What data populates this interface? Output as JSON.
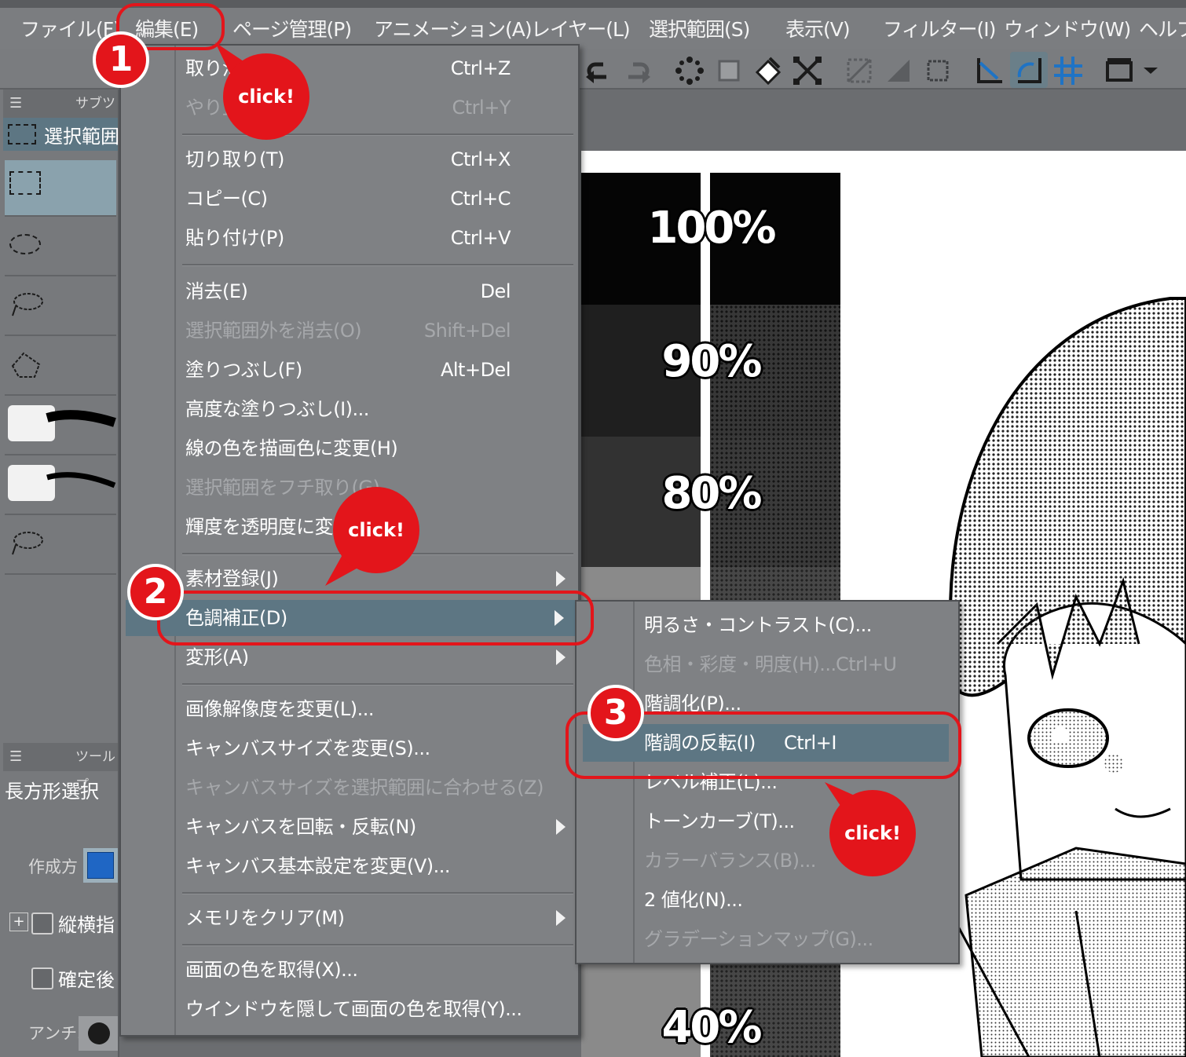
{
  "menubar": {
    "items": [
      "ファイル(F)",
      "編集(E)",
      "ページ管理(P)",
      "アニメーション(A)",
      "レイヤー(L)",
      "選択範囲(S)",
      "表示(V)",
      "フィルター(I)",
      "ウィンドウ(W)",
      "ヘルプ"
    ]
  },
  "left_panel": {
    "subtool_header": "サブツー",
    "subtool_selected": "選択範囲",
    "tool_header": "ツールプ",
    "tool_name": "長方形選択",
    "creation_label": "作成方",
    "aspect_label": "縦横指",
    "confirm_label": "確定後",
    "antialias_label": "アンチエ"
  },
  "edit_menu": {
    "items": [
      {
        "label": "取り消",
        "shortcut": "Ctrl+Z",
        "disabled": false
      },
      {
        "label": "やり直",
        "shortcut": "Ctrl+Y",
        "disabled": true
      },
      {
        "label": "切り取り(T)",
        "shortcut": "Ctrl+X",
        "disabled": false
      },
      {
        "label": "コピー(C)",
        "shortcut": "Ctrl+C",
        "disabled": false
      },
      {
        "label": "貼り付け(P)",
        "shortcut": "Ctrl+V",
        "disabled": false
      },
      {
        "label": "消去(E)",
        "shortcut": "Del",
        "disabled": false
      },
      {
        "label": "選択範囲外を消去(O)",
        "shortcut": "Shift+Del",
        "disabled": true
      },
      {
        "label": "塗りつぶし(F)",
        "shortcut": "Alt+Del",
        "disabled": false
      },
      {
        "label": "高度な塗りつぶし(I)...",
        "shortcut": "",
        "disabled": false
      },
      {
        "label": "線の色を描画色に変更(H)",
        "shortcut": "",
        "disabled": false
      },
      {
        "label": "選択範囲をフチ取り(G)",
        "shortcut": "",
        "disabled": true
      },
      {
        "label": "輝度を透明度に変",
        "shortcut": "",
        "disabled": false
      },
      {
        "label": "素材登録(J)",
        "shortcut": "",
        "disabled": false
      },
      {
        "label": "色調補正(D)",
        "shortcut": "",
        "disabled": false
      },
      {
        "label": "変形(A)",
        "shortcut": "",
        "disabled": false
      },
      {
        "label": "画像解像度を変更(L)...",
        "shortcut": "",
        "disabled": false
      },
      {
        "label": "キャンバスサイズを変更(S)...",
        "shortcut": "",
        "disabled": false
      },
      {
        "label": "キャンバスサイズを選択範囲に合わせる(Z)",
        "shortcut": "",
        "disabled": true
      },
      {
        "label": "キャンバスを回転・反転(N)",
        "shortcut": "",
        "disabled": false
      },
      {
        "label": "キャンバス基本設定を変更(V)...",
        "shortcut": "",
        "disabled": false
      },
      {
        "label": "メモリをクリア(M)",
        "shortcut": "",
        "disabled": false
      },
      {
        "label": "画面の色を取得(X)...",
        "shortcut": "",
        "disabled": false
      },
      {
        "label": "ウインドウを隠して画面の色を取得(Y)...",
        "shortcut": "",
        "disabled": false
      }
    ]
  },
  "sub_menu": {
    "items": [
      {
        "label": "明るさ・コントラスト(C)...",
        "shortcut": "",
        "disabled": false
      },
      {
        "label": "色相・彩度・明度(H)...",
        "shortcut": "Ctrl+U",
        "disabled": true
      },
      {
        "label": "階調化(P)...",
        "shortcut": "",
        "disabled": false
      },
      {
        "label": "階調の反転(I)",
        "shortcut": "Ctrl+I",
        "disabled": false
      },
      {
        "label": "レベル補正(L)...",
        "shortcut": "",
        "disabled": false
      },
      {
        "label": "トーンカーブ(T)...",
        "shortcut": "",
        "disabled": false
      },
      {
        "label": "カラーバランス(B)...",
        "shortcut": "",
        "disabled": true
      },
      {
        "label": "2 値化(N)...",
        "shortcut": "",
        "disabled": false
      },
      {
        "label": "グラデーションマップ(G)...",
        "shortcut": "",
        "disabled": true
      }
    ]
  },
  "canvas": {
    "tone_labels": [
      "100%",
      "90%",
      "80%",
      "40%"
    ]
  },
  "annotations": {
    "steps": [
      "1",
      "2",
      "3"
    ],
    "click_text": "click!"
  },
  "colors": {
    "highlight": "#5d7683",
    "annotation_red": "#e3151b"
  }
}
